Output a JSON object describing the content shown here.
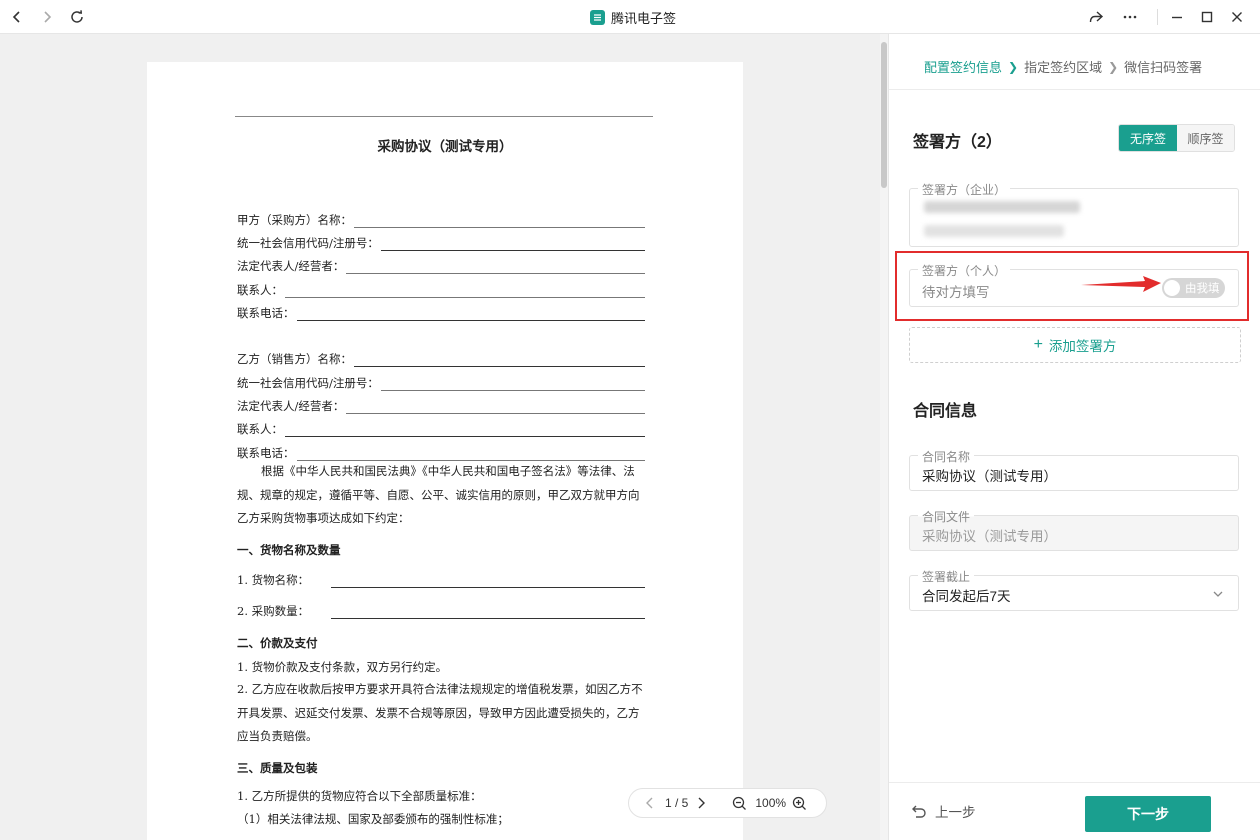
{
  "app": {
    "title": "腾讯电子签"
  },
  "document": {
    "title": "采购协议（测试专用）",
    "party_a": {
      "name_label": "甲方（采购方）名称：",
      "code_label": "统一社会信用代码/注册号：",
      "rep_label": "法定代表人/经营者：",
      "contact_label": "联系人：",
      "phone_label": "联系电话："
    },
    "party_b": {
      "name_label": "乙方（销售方）名称：",
      "code_label": "统一社会信用代码/注册号：",
      "rep_label": "法定代表人/经营者：",
      "contact_label": "联系人：",
      "phone_label": "联系电话："
    },
    "intro": "根据《中华人民共和国民法典》《中华人民共和国电子签名法》等法律、法规、规章的规定，遵循平等、自愿、公平、诚实信用的原则，甲乙双方就甲方向乙方采购货物事项达成如下约定：",
    "section1_title": "一、货物名称及数量",
    "s1_item1": "1. 货物名称：",
    "s1_item2": "2. 采购数量：",
    "section2_title": "二、价款及支付",
    "s2_line1": "1. 货物价款及支付条款，双方另行约定。",
    "s2_line2": "2. 乙方应在收款后按甲方要求开具符合法律法规规定的增值税发票，如因乙方不开具发票、迟延交付发票、发票不合规等原因，导致甲方因此遭受损失的，乙方应当负责赔偿。",
    "section3_title": "三、质量及包装",
    "s3_line1": "1. 乙方所提供的货物应符合以下全部质量标准：",
    "s3_line2": "（1）相关法律法规、国家及部委颁布的强制性标准；"
  },
  "pager": {
    "page": "1 / 5",
    "zoom": "100%"
  },
  "steps": [
    {
      "label": "配置签约信息"
    },
    {
      "label": "指定签约区域"
    },
    {
      "label": "微信扫码签署"
    }
  ],
  "signers": {
    "title": "签署方（2）",
    "mode_unordered": "无序签",
    "mode_ordered": "顺序签",
    "enterprise_label": "签署方（企业）",
    "personal_label": "签署方（个人）",
    "personal_value": "待对方填写",
    "toggle_label": "由我填",
    "add_label": "添加签署方"
  },
  "contract": {
    "title": "合同信息",
    "name_label": "合同名称",
    "name_value": "采购协议（测试专用）",
    "file_label": "合同文件",
    "file_value": "采购协议（测试专用）",
    "deadline_label": "签署截止",
    "deadline_value": "合同发起后7天"
  },
  "footer": {
    "prev_label": "上一步",
    "next_label": "下一步"
  },
  "colors": {
    "accent": "#1a9f8f",
    "highlight": "#e22c2c"
  }
}
